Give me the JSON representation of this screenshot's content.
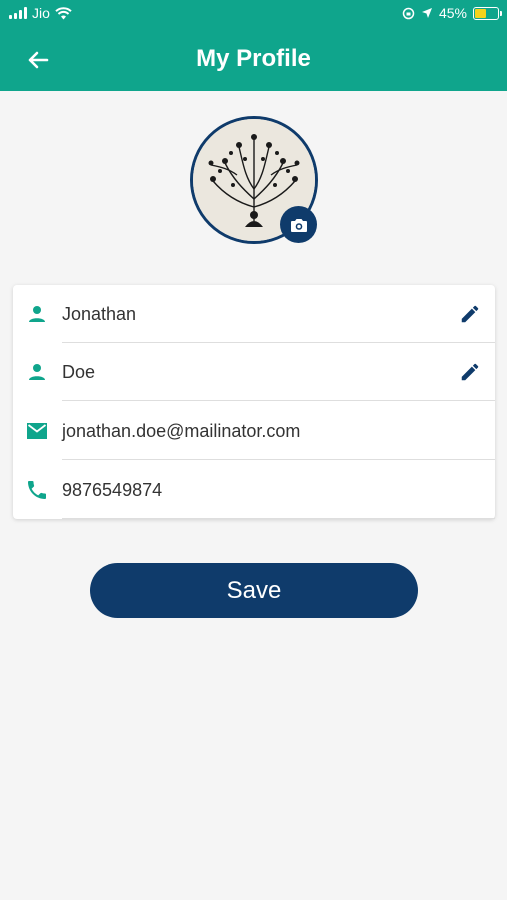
{
  "status": {
    "carrier": "Jio",
    "battery": "45%"
  },
  "header": {
    "title": "My Profile"
  },
  "colors": {
    "primary": "#0fa58c",
    "accent": "#0f3b6b",
    "battery": "#f5d31c"
  },
  "profile": {
    "first_name": "Jonathan",
    "last_name": "Doe",
    "email": "jonathan.doe@mailinator.com",
    "phone": "9876549874"
  },
  "icons": [
    "back-arrow-icon",
    "camera-icon",
    "person-icon",
    "pencil-icon",
    "email-icon",
    "phone-icon"
  ],
  "actions": {
    "save_label": "Save"
  }
}
